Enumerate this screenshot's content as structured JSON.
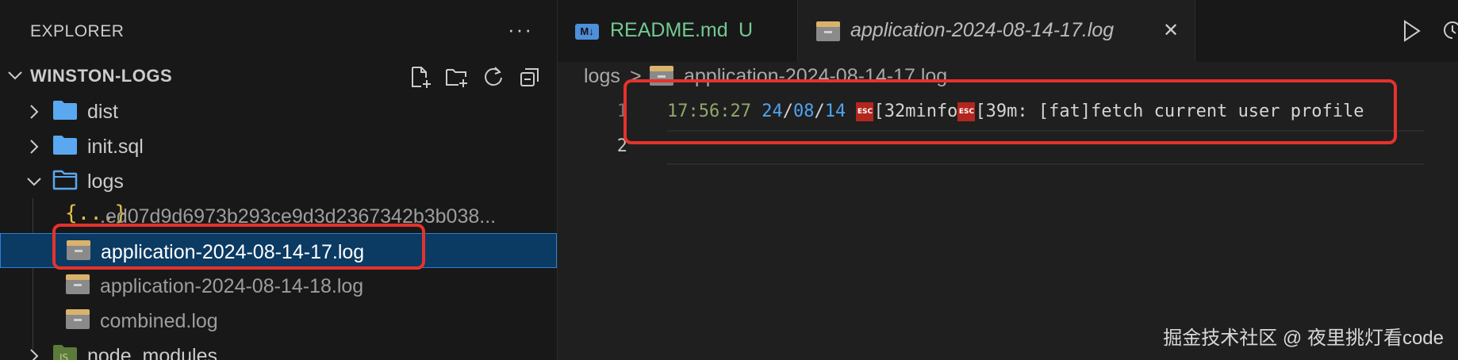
{
  "sidebar": {
    "title": "EXPLORER",
    "more_label": "···",
    "root_label": "WINSTON-LOGS",
    "items": [
      {
        "label": "dist",
        "type": "folder",
        "expanded": false
      },
      {
        "label": "init.sql",
        "type": "folder",
        "expanded": false
      },
      {
        "label": "logs",
        "type": "folder",
        "expanded": true
      },
      {
        "label": ".ed07d9d6973b293ce9d3d2367342b3b038...",
        "type": "json"
      },
      {
        "label": "application-2024-08-14-17.log",
        "type": "log",
        "selected": true
      },
      {
        "label": "application-2024-08-14-18.log",
        "type": "log"
      },
      {
        "label": "combined.log",
        "type": "log"
      },
      {
        "label": "node_modules",
        "type": "node-folder",
        "expanded": false
      }
    ]
  },
  "tabs": [
    {
      "label": "README.md",
      "status": "U",
      "icon": "markdown-icon"
    },
    {
      "label": "application-2024-08-14-17.log",
      "icon": "log-file-icon",
      "active": true,
      "close": "✕"
    }
  ],
  "breadcrumb": {
    "folder": "logs",
    "separator": ">",
    "file": "application-2024-08-14-17.log"
  },
  "editor": {
    "line_numbers": [
      "1",
      "2"
    ],
    "line1": {
      "time": "17:56:27",
      "date_year": "24",
      "date_sep1": "/",
      "date_month": "08",
      "date_sep2": "/",
      "date_day": "14",
      "esc_label": "ESC",
      "part1": "[32minfo",
      "part2": "[39m: [fat]fetch current user profile"
    }
  },
  "watermark": "掘金技术社区 @ 夜里挑灯看code",
  "colors": {
    "selection_bg": "#0b3a63",
    "highlight_box": "#e5322d",
    "time": "#8fa86b",
    "date": "#4fa3f0",
    "folder": "#5aa8f0",
    "tab_modified": "#73c991"
  }
}
